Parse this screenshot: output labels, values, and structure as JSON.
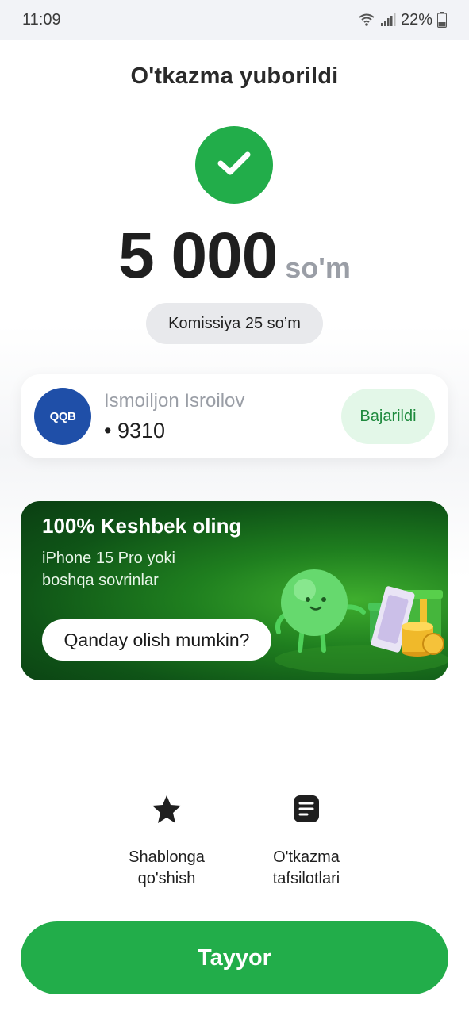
{
  "status_bar": {
    "time": "11:09",
    "battery": "22%",
    "icons": [
      "wifi-icon",
      "signal-icon",
      "battery-icon"
    ]
  },
  "header": {
    "title": "O'tkazma yuborildi"
  },
  "success": {
    "icon": "checkmark-icon",
    "color": "#22ad4a"
  },
  "transfer": {
    "amount": "5 000",
    "currency": "so'm",
    "commission": "Komissiya 25 so’m"
  },
  "recipient": {
    "bank_logo_text": "QQB",
    "name": "Ismoiljon Isroilov",
    "card": "• 9310",
    "status": "Bajarildi"
  },
  "promo": {
    "title": "100% Keshbek oling",
    "subtitle_line1": "iPhone 15 Pro yoki",
    "subtitle_line2": "boshqa sovrinlar",
    "button": "Qanday olish mumkin?"
  },
  "actions": [
    {
      "icon": "star-icon",
      "line1": "Shablonga",
      "line2": "qo'shish"
    },
    {
      "icon": "document-icon",
      "line1": "O'tkazma",
      "line2": "tafsilotlari"
    }
  ],
  "footer": {
    "done_label": "Tayyor"
  },
  "colors": {
    "accent": "#22ad4a",
    "accent_light": "#e3f7e8",
    "bank_blue": "#1f4fa8"
  }
}
